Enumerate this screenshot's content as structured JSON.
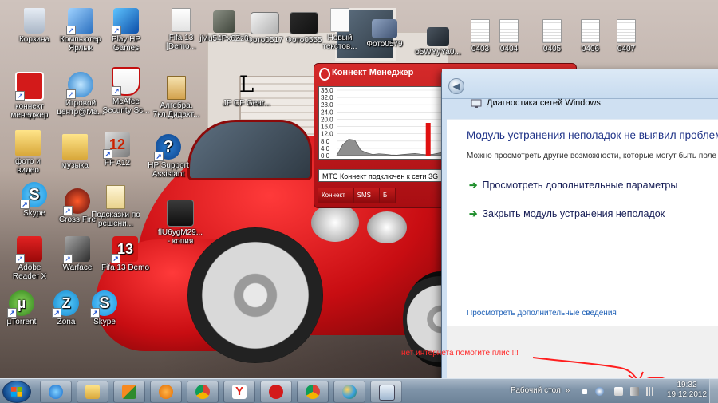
{
  "desktop": {
    "icons": [
      {
        "name": "recycle-bin-icon",
        "label": "Корзина"
      },
      {
        "name": "computer-shortcut-icon",
        "label": "Компьютер Ярлык"
      },
      {
        "name": "play-hp-games-icon",
        "label": "Play HP Games"
      },
      {
        "name": "fifa13-demo-icon",
        "label": "Fifa 13 [Demo..."
      },
      {
        "name": "photo-thumbnail-icon",
        "label": "jMu54Px6Zz0"
      },
      {
        "name": "photo-thumbnail-icon",
        "label": "Фото0517"
      },
      {
        "name": "photo-thumbnail-icon",
        "label": "Фото0555"
      },
      {
        "name": "text-file-icon",
        "label": "Новый текстов..."
      },
      {
        "name": "photo-thumbnail-icon",
        "label": "Фото0579"
      },
      {
        "name": "photo-thumbnail-icon",
        "label": "o5WYyYa0..."
      },
      {
        "name": "document-thumbnail-icon",
        "label": "0403"
      },
      {
        "name": "document-thumbnail-icon",
        "label": "0404"
      },
      {
        "name": "document-thumbnail-icon",
        "label": "0405"
      },
      {
        "name": "document-thumbnail-icon",
        "label": "0406"
      },
      {
        "name": "document-thumbnail-icon",
        "label": "0407"
      },
      {
        "name": "connect-manager-icon",
        "label": "коннект менеджер"
      },
      {
        "name": "game-center-icon",
        "label": "Игровой центр@Ma..."
      },
      {
        "name": "mcafee-icon",
        "label": "McAfee Security Sc..."
      },
      {
        "name": "algebra-book-icon",
        "label": "Алгебра. 7кл.Дидакт..."
      },
      {
        "name": "l-logo-icon",
        "label": "JF CF Gear..."
      },
      {
        "name": "folder-icon",
        "label": "фото и видео"
      },
      {
        "name": "folder-icon",
        "label": "музыка"
      },
      {
        "name": "ff12-icon",
        "label": "FF A12"
      },
      {
        "name": "hp-support-icon",
        "label": "HP Support Assistant"
      },
      {
        "name": "skype-icon",
        "label": "Skype"
      },
      {
        "name": "crossfire-icon",
        "label": "Cross Fire"
      },
      {
        "name": "hints-document-icon",
        "label": "Подсказки по решени..."
      },
      {
        "name": "adobe-reader-icon",
        "label": "Adobe Reader X"
      },
      {
        "name": "warface-icon",
        "label": "Warface"
      },
      {
        "name": "fifa13-demo-red-icon",
        "label": "Fifa 13 Demo"
      },
      {
        "name": "flash-video-icon",
        "label": "flU6ygM29... - копия"
      },
      {
        "name": "utorrent-icon",
        "label": "µTorrent"
      },
      {
        "name": "zona-icon",
        "label": "Zona"
      },
      {
        "name": "skype-icon",
        "label": "Skype"
      }
    ]
  },
  "connect_manager": {
    "title": "Коннект Менеджер",
    "graph": {
      "y_ticks": [
        "36.0",
        "32.0",
        "28.0",
        "24.0",
        "20.0",
        "16.0",
        "12.0",
        "8.0",
        "4.0",
        "0.0"
      ],
      "levels": [
        0.0,
        6.0,
        9.0,
        8.5,
        3.0,
        1.5,
        0.6,
        1.0,
        0.8,
        0.4,
        0.3,
        0.6,
        0.9,
        1.2,
        0.8,
        0.5,
        0.7,
        1.4,
        2.2,
        3.0,
        2.4,
        1.6,
        1.9,
        2.8,
        3.5,
        4.5,
        3.9,
        3.1,
        2.1,
        1.3,
        0.9,
        0.7,
        1.1,
        0.8,
        0.6,
        0.4,
        0.3,
        0.6,
        0.9,
        0.5
      ],
      "peak_value": 18.0,
      "accent": "#e01010"
    },
    "status_text": "МТС Коннект подключен к сети 3G",
    "tabs": [
      "Коннект",
      "SMS",
      "Б"
    ]
  },
  "diagnostics": {
    "window_title": "Диагностика сетей Windows",
    "heading": "Модуль устранения неполадок не выявил проблем",
    "subtext": "Можно просмотреть другие возможности, которые могут быть поле",
    "option1": "Просмотреть дополнительные параметры",
    "option2": "Закрыть модуль устранения неполадок",
    "detail_link": "Просмотреть дополнительные сведения",
    "arrow_color": "#1d8d2a"
  },
  "annotation": {
    "note_text": "нет интернета помогите плис !!!",
    "color": "#ff2020"
  },
  "taskbar": {
    "show_desktop_label": "Рабочий стол",
    "chevron": "»",
    "time": "19:32",
    "date": "19.12.2012",
    "pinned": [
      "internet-explorer-icon",
      "explorer-folder-icon",
      "office-icon",
      "media-player-icon",
      "chrome-icon",
      "yandex-icon",
      "connect-manager-icon",
      "chrome-icon",
      "paint-icon",
      "monitor-icon"
    ]
  }
}
